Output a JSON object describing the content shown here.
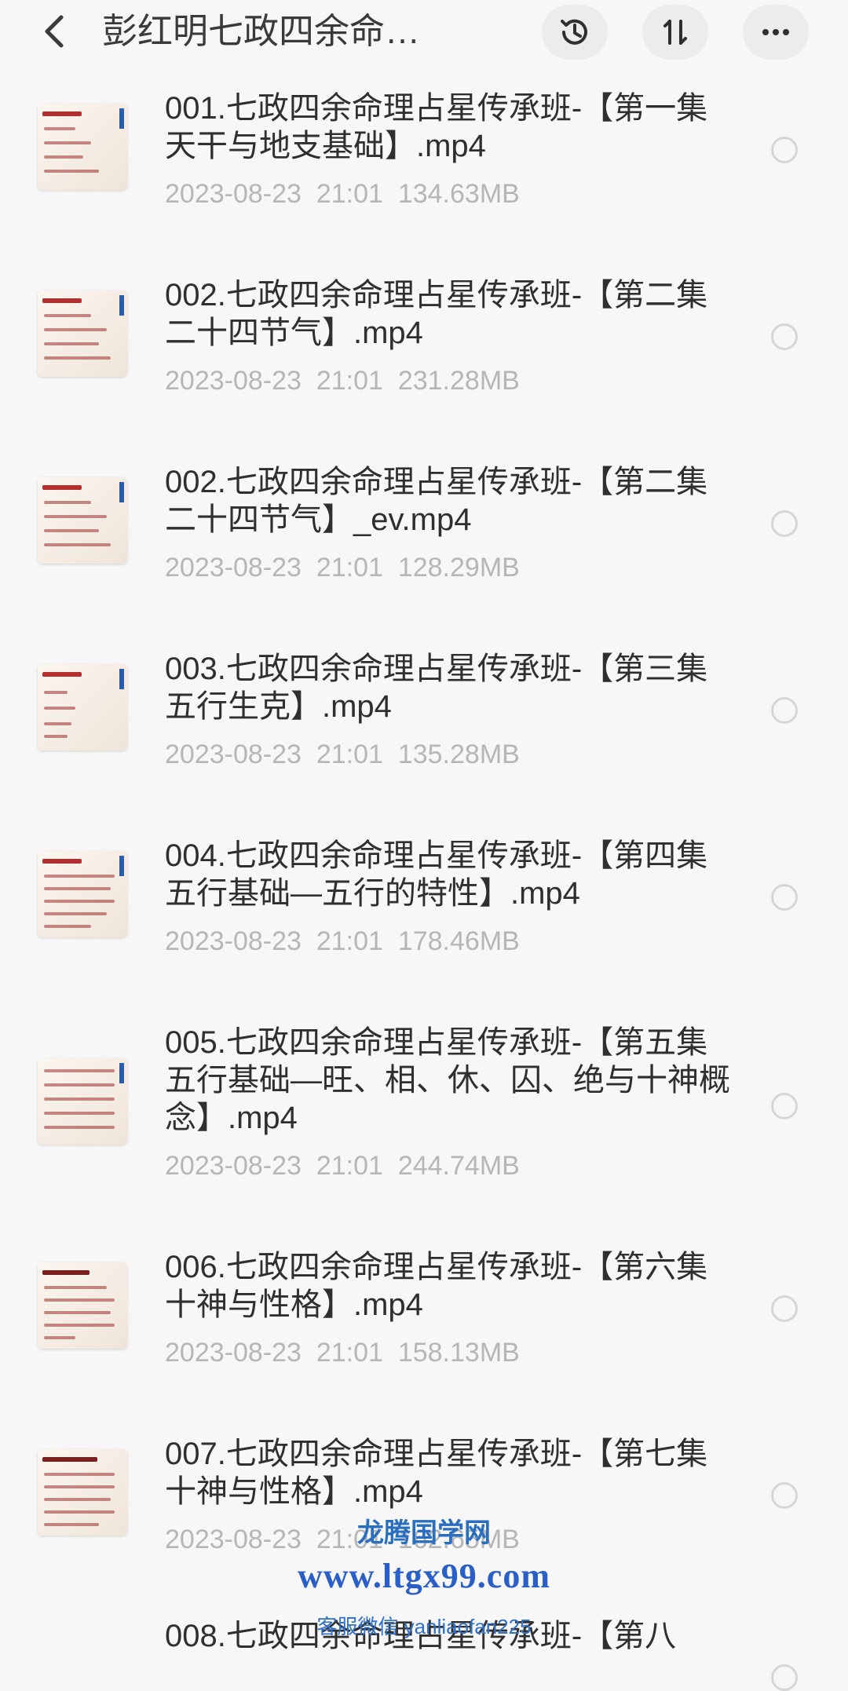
{
  "header": {
    "title": "彭红明七政四余命…",
    "icons": {
      "back": "chevron-left-icon",
      "history": "history-clock-icon",
      "sort": "sort-arrows-icon",
      "more": "more-dots-icon"
    }
  },
  "files": [
    {
      "name": "001.七政四余命理占星传承班-【第一集 天干与地支基础】.mp4",
      "date": "2023-08-23",
      "time": "21:01",
      "size": "134.63MB"
    },
    {
      "name": "002.七政四余命理占星传承班-【第二集  二十四节气】.mp4",
      "date": "2023-08-23",
      "time": "21:01",
      "size": "231.28MB"
    },
    {
      "name": "002.七政四余命理占星传承班-【第二集  二十四节气】_ev.mp4",
      "date": "2023-08-23",
      "time": "21:01",
      "size": "128.29MB"
    },
    {
      "name": "003.七政四余命理占星传承班-【第三集  五行生克】.mp4",
      "date": "2023-08-23",
      "time": "21:01",
      "size": "135.28MB"
    },
    {
      "name": "004.七政四余命理占星传承班-【第四集  五行基础—五行的特性】.mp4",
      "date": "2023-08-23",
      "time": "21:01",
      "size": "178.46MB"
    },
    {
      "name": "005.七政四余命理占星传承班-【第五集  五行基础—旺、相、休、囚、绝与十神概念】.mp4",
      "date": "2023-08-23",
      "time": "21:01",
      "size": "244.74MB"
    },
    {
      "name": "006.七政四余命理占星传承班-【第六集  十神与性格】.mp4",
      "date": "2023-08-23",
      "time": "21:01",
      "size": "158.13MB"
    },
    {
      "name": "007.七政四余命理占星传承班-【第七集  十神与性格】.mp4",
      "date": "2023-08-23",
      "time": "21:01",
      "size": "162.65MB"
    },
    {
      "name": "008.七政四余命理占星传承班-【第八",
      "date": "",
      "time": "",
      "size": ""
    }
  ],
  "watermark": {
    "line1": "龙腾国学网",
    "line2": "www.ltgx99.com",
    "line3": "客服微信 yanliaofan225"
  }
}
